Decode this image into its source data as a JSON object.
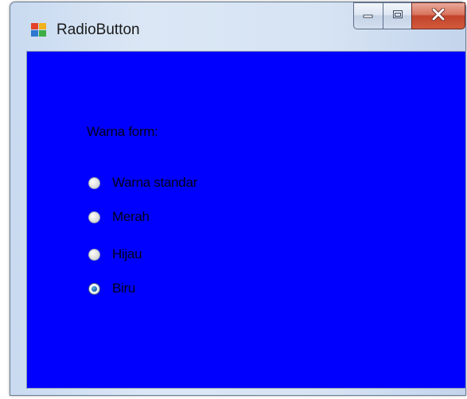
{
  "window": {
    "title": "RadioButton",
    "client_background_color": "#0000ff",
    "icons": {
      "app": "windows-form-icon",
      "minimize": "minimize-icon",
      "maximize": "maximize-icon",
      "close": "close-icon"
    }
  },
  "form": {
    "label": "Warna form:",
    "options": [
      {
        "label": "Warna standar",
        "checked": false
      },
      {
        "label": "Merah",
        "checked": false
      },
      {
        "label": "Hijau",
        "checked": false
      },
      {
        "label": "Biru",
        "checked": true
      }
    ]
  }
}
